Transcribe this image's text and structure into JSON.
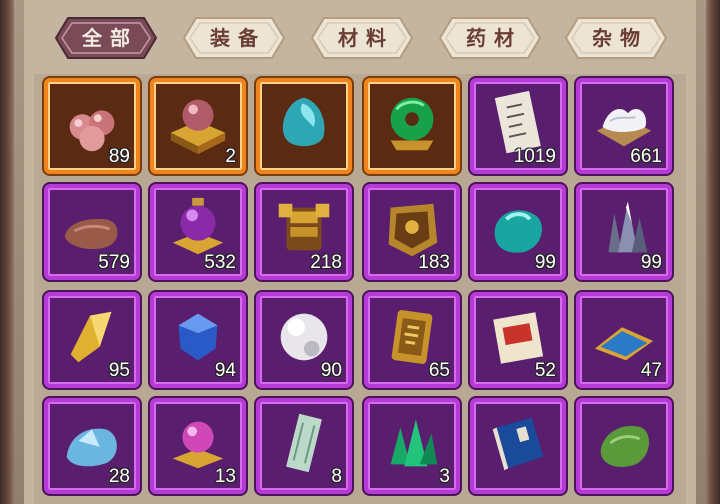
{
  "tabs": [
    {
      "label": "全部",
      "active": true
    },
    {
      "label": "装备",
      "active": false
    },
    {
      "label": "材料",
      "active": false
    },
    {
      "label": "药材",
      "active": false
    },
    {
      "label": "杂物",
      "active": false
    }
  ],
  "colors": {
    "orange_rarity": "#f0851e",
    "purple_rarity": "#b63ad6",
    "tab_active": "#7a4a58",
    "tab_idle": "#ece4d4"
  },
  "items": [
    {
      "icon": "pink-pearls-icon",
      "rarity": "orange",
      "count": "89"
    },
    {
      "icon": "orb-on-stand-icon",
      "rarity": "orange",
      "count": "2"
    },
    {
      "icon": "cyan-gem-icon",
      "rarity": "orange",
      "count": ""
    },
    {
      "icon": "jade-ring-icon",
      "rarity": "orange",
      "count": ""
    },
    {
      "icon": "scroll-paper-icon",
      "rarity": "purple",
      "count": "1019"
    },
    {
      "icon": "white-cloth-icon",
      "rarity": "purple",
      "count": "661"
    },
    {
      "icon": "brown-stone-icon",
      "rarity": "purple",
      "count": "579"
    },
    {
      "icon": "purple-orb-relic-icon",
      "rarity": "purple",
      "count": "532"
    },
    {
      "icon": "golden-armor-icon",
      "rarity": "purple",
      "count": "218"
    },
    {
      "icon": "gold-plaque-icon",
      "rarity": "purple",
      "count": "183"
    },
    {
      "icon": "teal-gem-icon",
      "rarity": "purple",
      "count": "99"
    },
    {
      "icon": "crystal-cluster-icon",
      "rarity": "purple",
      "count": "99"
    },
    {
      "icon": "gold-shard-icon",
      "rarity": "purple",
      "count": "95"
    },
    {
      "icon": "blue-sapphire-icon",
      "rarity": "purple",
      "count": "94"
    },
    {
      "icon": "white-pearl-icon",
      "rarity": "purple",
      "count": "90"
    },
    {
      "icon": "gold-token-icon",
      "rarity": "purple",
      "count": "65"
    },
    {
      "icon": "red-seal-letter-icon",
      "rarity": "purple",
      "count": "52"
    },
    {
      "icon": "blue-cloth-icon",
      "rarity": "purple",
      "count": "47"
    },
    {
      "icon": "ice-crystal-icon",
      "rarity": "purple",
      "count": "28"
    },
    {
      "icon": "pink-orb-stand-icon",
      "rarity": "purple",
      "count": "13"
    },
    {
      "icon": "jade-slip-icon",
      "rarity": "purple",
      "count": "8"
    },
    {
      "icon": "emerald-cluster-icon",
      "rarity": "purple",
      "count": "3"
    },
    {
      "icon": "blue-book-icon",
      "rarity": "purple",
      "count": ""
    },
    {
      "icon": "green-ore-icon",
      "rarity": "purple",
      "count": ""
    }
  ]
}
